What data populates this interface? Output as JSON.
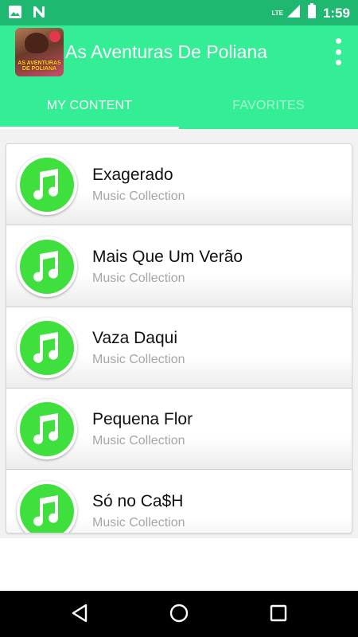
{
  "status_bar": {
    "time": "1:59",
    "network_label": "LTE",
    "bg_color": "#1fb870",
    "icons": [
      "image-icon",
      "notification-n-icon",
      "signal-icon",
      "battery-icon"
    ]
  },
  "app_bar": {
    "title": "As Aventuras De Poliana",
    "icon_text": "AS AVENTURAS DE POLIANA",
    "bg_color": "#33ee94"
  },
  "tabs": [
    {
      "label": "MY CONTENT",
      "active": true
    },
    {
      "label": "FAVORITES",
      "active": false
    }
  ],
  "list": {
    "items": [
      {
        "title": "Exagerado",
        "subtitle": "Music Collection"
      },
      {
        "title": "Mais Que Um Verão",
        "subtitle": "Music Collection"
      },
      {
        "title": "Vaza Daqui",
        "subtitle": "Music Collection"
      },
      {
        "title": "Pequena Flor",
        "subtitle": "Music Collection"
      },
      {
        "title": "Só no Ca$H",
        "subtitle": "Music Collection"
      }
    ],
    "item_icon": "music-note-icon",
    "icon_color": "#3fe03d"
  },
  "nav_bar": {
    "buttons": [
      "back-icon",
      "home-icon",
      "recents-icon"
    ]
  }
}
